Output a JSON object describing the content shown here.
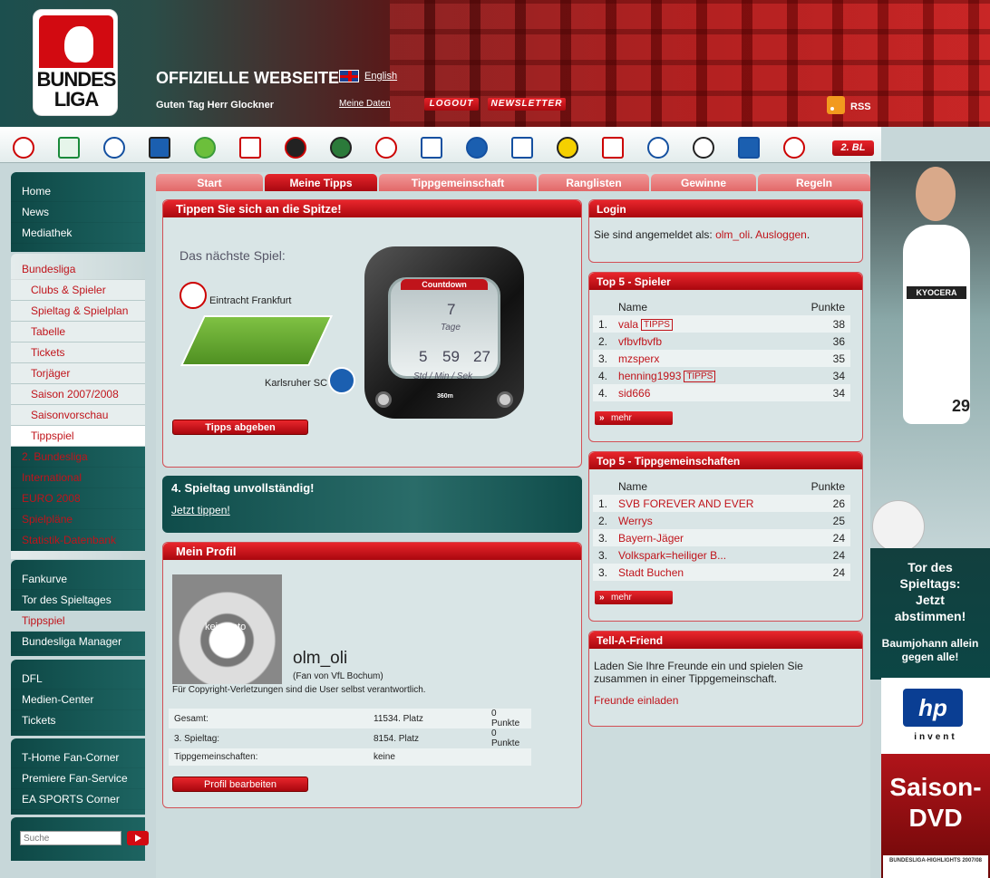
{
  "header": {
    "logo_line1": "BUNDES",
    "logo_line2": "LIGA",
    "site_title": "OFFIZIELLE WEBSEITE",
    "language": "English",
    "greeting": "Guten Tag Herr Glockner",
    "my_data": "Meine Daten",
    "logout": "LOGOUT",
    "newsletter": "NEWSLETTER",
    "rss": "RSS"
  },
  "club_bar": {
    "second_league": "2. BL"
  },
  "nav": {
    "group1": [
      "Home",
      "News",
      "Mediathek"
    ],
    "bundesliga": "Bundesliga",
    "bundesliga_sub": [
      "Clubs & Spieler",
      "Spieltag & Spielplan",
      "Tabelle",
      "Tickets",
      "Torjäger",
      "Saison 2007/2008",
      "Saisonvorschau",
      "Tippspiel"
    ],
    "group2_rest": [
      "2. Bundesliga",
      "International",
      "EURO 2008",
      "Spielpläne",
      "Statistik-Datenbank"
    ],
    "group3": [
      "Fankurve",
      "Tor des Spieltages",
      "Tippspiel",
      "Bundesliga Manager"
    ],
    "group4": [
      "DFL",
      "Medien-Center",
      "Tickets"
    ],
    "group5": [
      "T-Home Fan-Corner",
      "Premiere Fan-Service",
      "EA SPORTS Corner"
    ],
    "search_placeholder": "Suche"
  },
  "tabs": [
    "Start",
    "Meine Tipps",
    "Tippgemeinschaft",
    "Ranglisten",
    "Gewinne",
    "Regeln"
  ],
  "tipp_panel": {
    "title": "Tippen Sie sich an die Spitze!",
    "next_game": "Das nächste Spiel:",
    "home_team": "Eintracht Frankfurt",
    "away_team": "Karlsruher SC",
    "submit": "Tipps abgeben",
    "countdown": {
      "label": "Countdown",
      "days": "7",
      "days_label": "Tage",
      "hours": "5",
      "minutes": "59",
      "seconds": "27",
      "units": "Std / Min / Sek",
      "brand": "360m"
    }
  },
  "incomplete": {
    "title": "4. Spieltag unvollständig!",
    "link": "Jetzt tippen!"
  },
  "profile": {
    "title": "Mein Profil",
    "no_photo": "kein Foto",
    "username": "olm_oli",
    "fan_of": "(Fan von VfL Bochum)",
    "copyright": "Für Copyright-Verletzungen sind die User selbst verantwortlich.",
    "rows": [
      {
        "label": "Gesamt:",
        "place": "11534. Platz",
        "points": "0 Punkte"
      },
      {
        "label": "3. Spieltag:",
        "place": "8154. Platz",
        "points": "0 Punkte"
      },
      {
        "label": "Tippgemeinschaften:",
        "place": "keine",
        "points": ""
      }
    ],
    "edit": "Profil bearbeiten"
  },
  "login": {
    "title": "Login",
    "text": "Sie sind angemeldet als:",
    "user": "olm_oli",
    "sep": ".",
    "logout": "Ausloggen",
    "end": "."
  },
  "top_players": {
    "title": "Top 5 - Spieler",
    "col_name": "Name",
    "col_points": "Punkte",
    "more": "mehr",
    "rows": [
      {
        "rank": "1.",
        "name": "vala",
        "tipps": "TIPPS",
        "points": "38"
      },
      {
        "rank": "2.",
        "name": "vfbvfbvfb",
        "tipps": "",
        "points": "36"
      },
      {
        "rank": "3.",
        "name": "mzsperx",
        "tipps": "",
        "points": "35"
      },
      {
        "rank": "4.",
        "name": "henning1993",
        "tipps": "TIPPS",
        "points": "34"
      },
      {
        "rank": "4.",
        "name": "sid666",
        "tipps": "",
        "points": "34"
      }
    ]
  },
  "top_groups": {
    "title": "Top 5 - Tippgemeinschaften",
    "col_name": "Name",
    "col_points": "Punkte",
    "more": "mehr",
    "rows": [
      {
        "rank": "1.",
        "name": "SVB FOREVER AND EVER",
        "points": "26"
      },
      {
        "rank": "2.",
        "name": "Werrys",
        "points": "25"
      },
      {
        "rank": "3.",
        "name": "Bayern-Jäger",
        "points": "24"
      },
      {
        "rank": "3.",
        "name": "Volkspark=heiliger B...",
        "points": "24"
      },
      {
        "rank": "3.",
        "name": "Stadt Buchen",
        "points": "24"
      }
    ]
  },
  "tell_friend": {
    "title": "Tell-A-Friend",
    "text": "Laden Sie Ihre Freunde ein und spielen Sie zusammen in einer Tippgemeinschaft.",
    "link": "Freunde einladen"
  },
  "ads": {
    "player_shirt": "KYOCERA",
    "player_number": "29",
    "tor_line1": "Tor des",
    "tor_line2": "Spieltags:",
    "tor_line3": "Jetzt",
    "tor_line4": "abstimmen!",
    "tor_sub1": "Baumjohann allein",
    "tor_sub2": "gegen alle!",
    "hp_logo": "hp",
    "hp_invent": "invent",
    "dvd_line1": "Saison-",
    "dvd_line2": "DVD",
    "dvd_small": "BUNDESLIGA-HIGHLIGHTS 2007/08"
  },
  "colors": {
    "brand_red": "#d20a11",
    "teal": "#0e4846",
    "panel": "#d9e5e6"
  }
}
